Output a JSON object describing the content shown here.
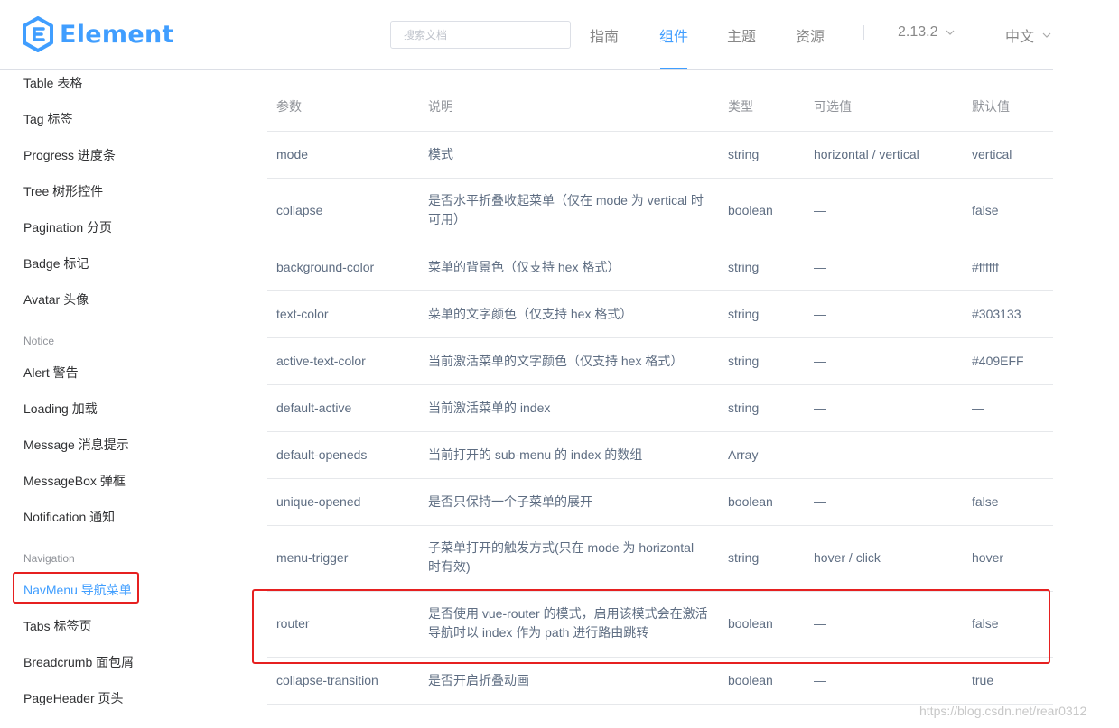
{
  "brand": {
    "name": "Element",
    "color": "#409eff"
  },
  "search": {
    "placeholder": "搜索文档"
  },
  "nav": {
    "links": [
      "指南",
      "组件",
      "主题",
      "资源"
    ],
    "active_index": 1,
    "version": "2.13.2",
    "language": "中文"
  },
  "sidebar": {
    "items_top": [
      "Table 表格",
      "Tag 标签",
      "Progress 进度条",
      "Tree 树形控件",
      "Pagination 分页",
      "Badge 标记",
      "Avatar 头像"
    ],
    "group_notice": "Notice",
    "items_notice": [
      "Alert 警告",
      "Loading 加载",
      "Message 消息提示",
      "MessageBox 弹框",
      "Notification 通知"
    ],
    "group_navigation": "Navigation",
    "items_navigation": [
      "NavMenu 导航菜单",
      "Tabs 标签页",
      "Breadcrumb 面包屑",
      "PageHeader 页头"
    ],
    "active_item": "NavMenu 导航菜单"
  },
  "table": {
    "headers": [
      "参数",
      "说明",
      "类型",
      "可选值",
      "默认值"
    ],
    "rows": [
      [
        "mode",
        "模式",
        "string",
        "horizontal / vertical",
        "vertical"
      ],
      [
        "collapse",
        "是否水平折叠收起菜单（仅在 mode 为 vertical 时可用）",
        "boolean",
        "—",
        "false"
      ],
      [
        "background-color",
        "菜单的背景色（仅支持 hex 格式）",
        "string",
        "—",
        "#ffffff"
      ],
      [
        "text-color",
        "菜单的文字颜色（仅支持 hex 格式）",
        "string",
        "—",
        "#303133"
      ],
      [
        "active-text-color",
        "当前激活菜单的文字颜色（仅支持 hex 格式）",
        "string",
        "—",
        "#409EFF"
      ],
      [
        "default-active",
        "当前激活菜单的 index",
        "string",
        "—",
        "—"
      ],
      [
        "default-openeds",
        "当前打开的 sub-menu 的 index 的数组",
        "Array",
        "—",
        "—"
      ],
      [
        "unique-opened",
        "是否只保持一个子菜单的展开",
        "boolean",
        "—",
        "false"
      ],
      [
        "menu-trigger",
        "子菜单打开的触发方式(只在 mode 为 horizontal 时有效)",
        "string",
        "hover / click",
        "hover"
      ],
      [
        "router",
        "是否使用 vue-router 的模式，启用该模式会在激活导航时以 index 作为 path 进行路由跳转",
        "boolean",
        "—",
        "false"
      ],
      [
        "collapse-transition",
        "是否开启折叠动画",
        "boolean",
        "—",
        "true"
      ]
    ],
    "highlighted_row": "router"
  },
  "watermark": "https://blog.csdn.net/rear0312",
  "colors": {
    "accent": "#409eff",
    "highlight": "#e62020",
    "text": "#5e6d82",
    "muted": "#909399"
  }
}
